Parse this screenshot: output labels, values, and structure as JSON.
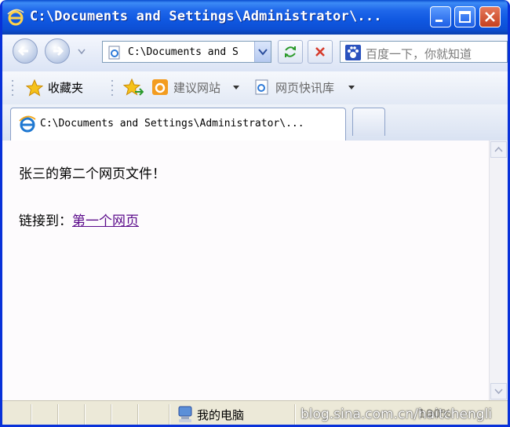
{
  "window": {
    "title": "C:\\Documents and Settings\\Administrator\\..."
  },
  "toolbar": {
    "address": "C:\\Documents and S",
    "search_placeholder": "百度一下，你就知道"
  },
  "favorites": {
    "label": "收藏夹",
    "items": [
      {
        "label": "建议网站"
      },
      {
        "label": "网页快讯库"
      }
    ]
  },
  "tabs": [
    {
      "label": "C:\\Documents and Settings\\Administrator\\..."
    }
  ],
  "page": {
    "heading": "张三的第二个网页文件！",
    "link_prefix": "链接到：",
    "link_text": "第一个网页"
  },
  "statusbar": {
    "zone": "我的电脑",
    "watermark": "blog.sina.com.cn/haitchengli",
    "zoom": "100%"
  },
  "colors": {
    "title_bar": "#0a4ccf",
    "link_visited": "#5a0a8a",
    "close_button": "#c4401f"
  }
}
